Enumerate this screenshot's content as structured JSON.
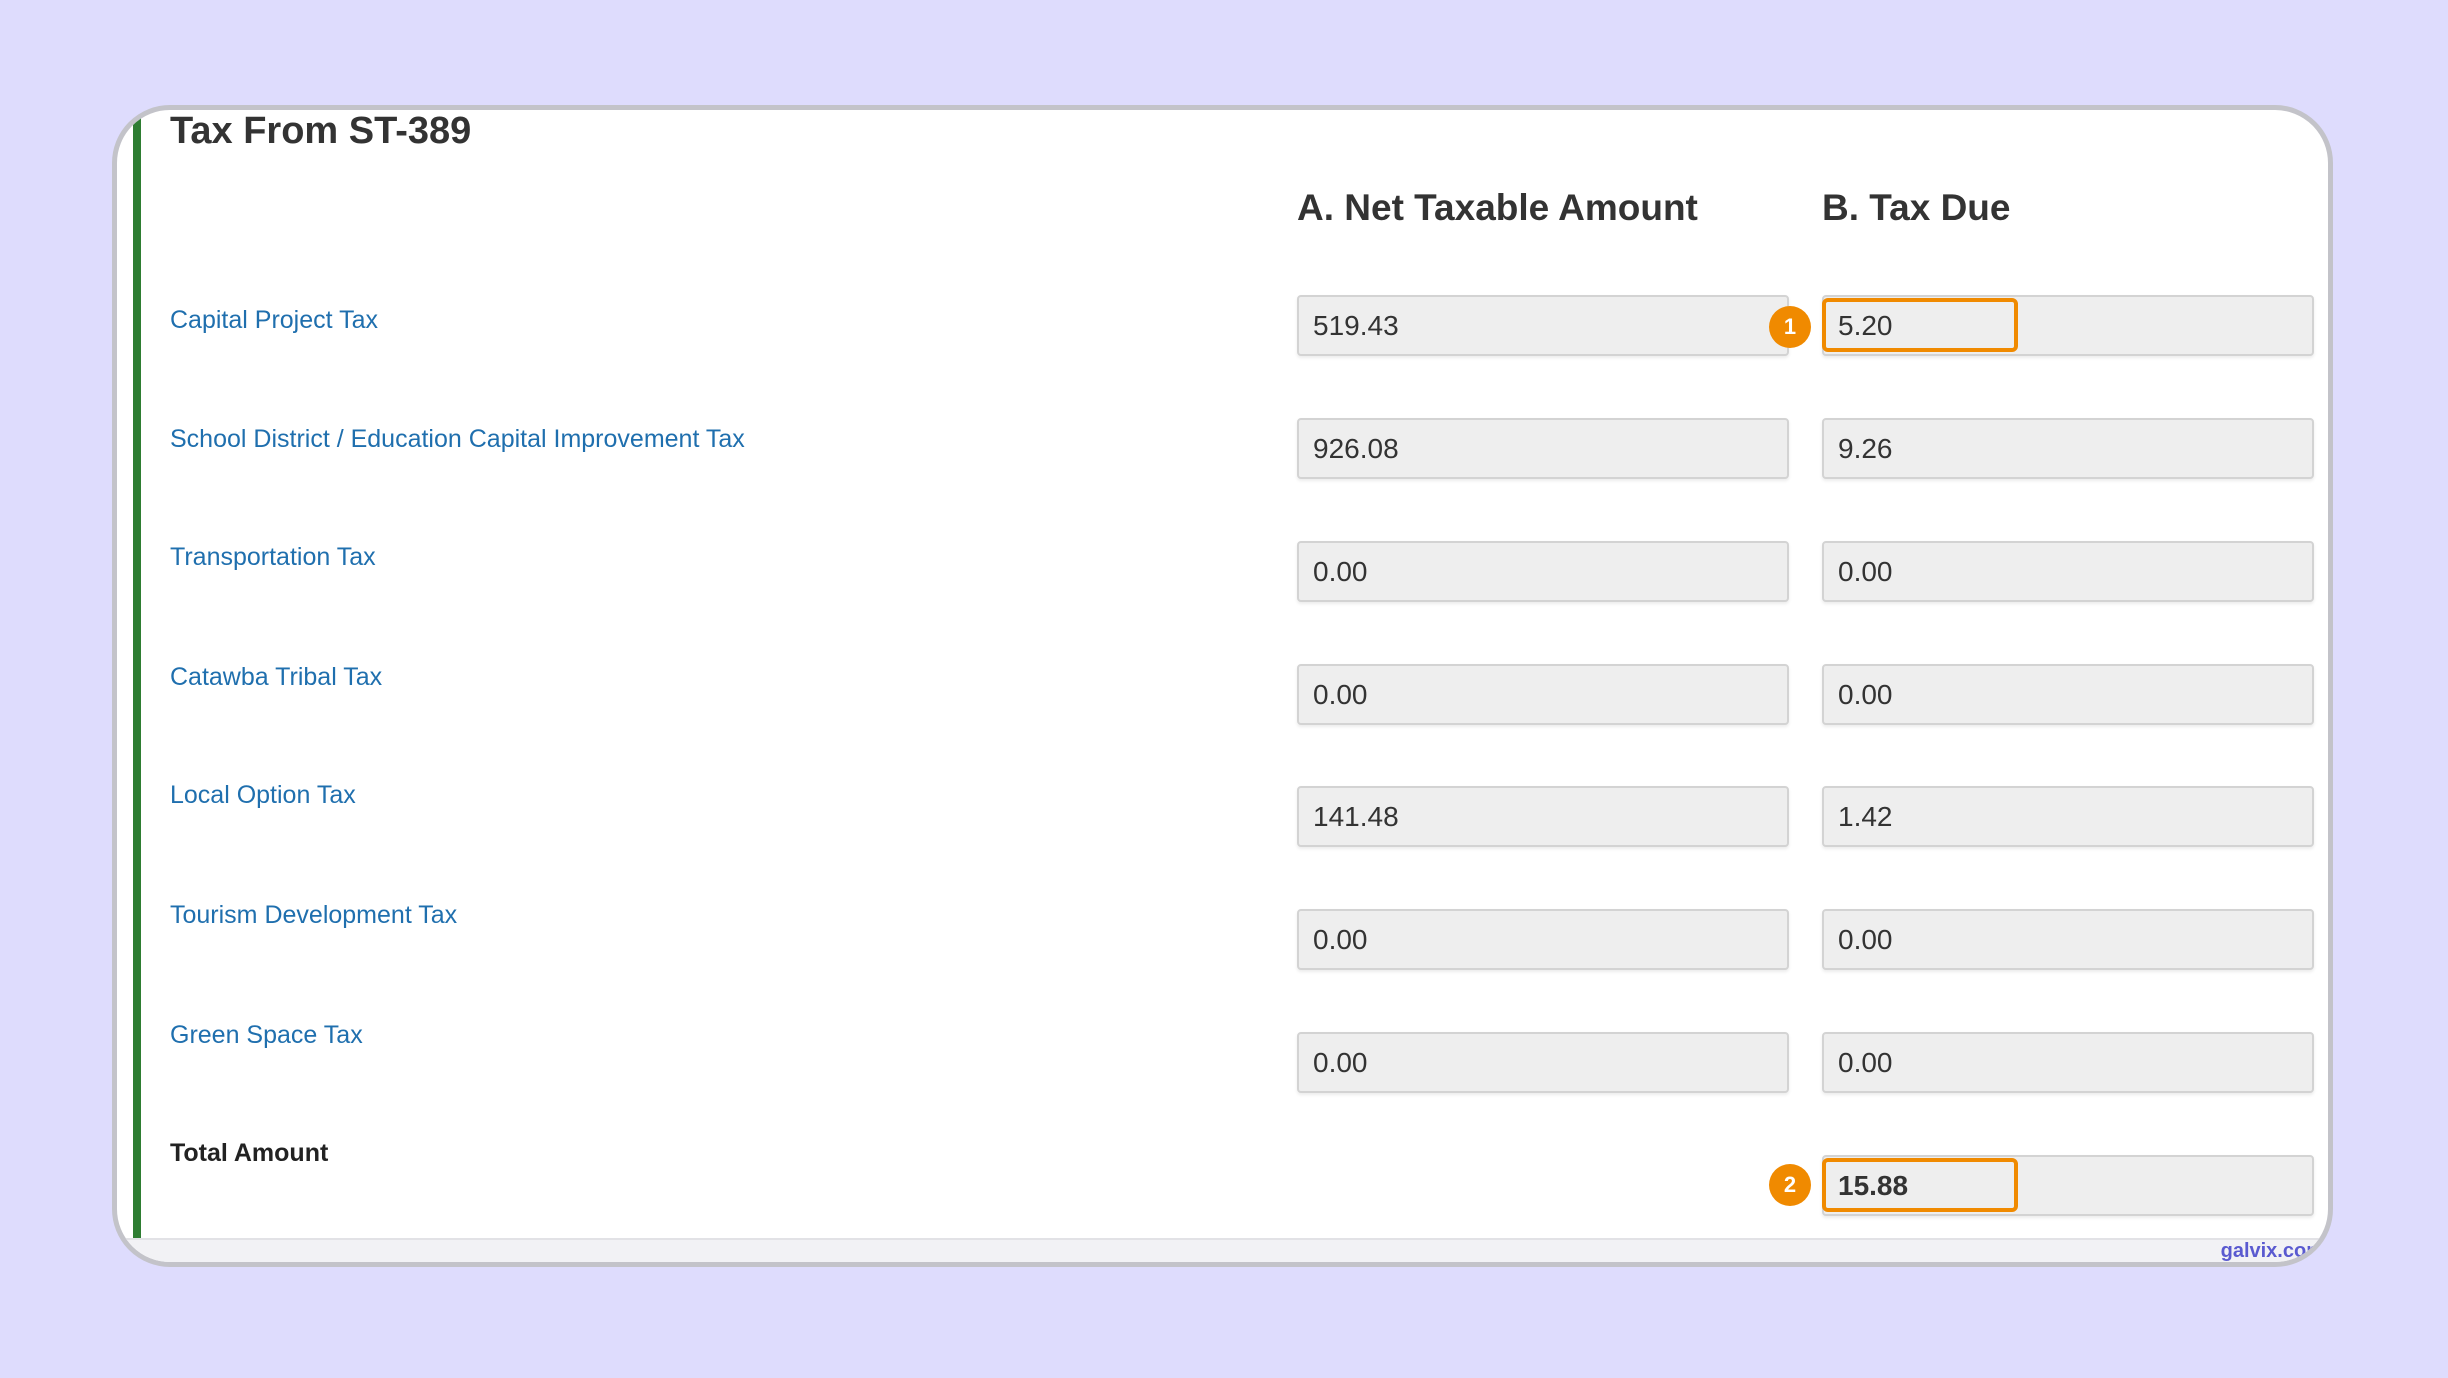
{
  "form": {
    "title": "Tax From ST-389",
    "col_a_header": "A. Net Taxable Amount",
    "col_b_header": "B. Tax Due",
    "rows": [
      {
        "label": "Capital Project Tax",
        "net_taxable": "519.43",
        "tax_due": "5.20"
      },
      {
        "label": "School District / Education Capital Improvement Tax",
        "net_taxable": "926.08",
        "tax_due": "9.26"
      },
      {
        "label": "Transportation Tax",
        "net_taxable": "0.00",
        "tax_due": "0.00"
      },
      {
        "label": "Catawba Tribal Tax",
        "net_taxable": "0.00",
        "tax_due": "0.00"
      },
      {
        "label": "Local Option Tax",
        "net_taxable": "141.48",
        "tax_due": "1.42"
      },
      {
        "label": "Tourism Development Tax",
        "net_taxable": "0.00",
        "tax_due": "0.00"
      },
      {
        "label": "Green Space Tax",
        "net_taxable": "0.00",
        "tax_due": "0.00"
      }
    ],
    "total": {
      "label": "Total Amount",
      "tax_due": "15.88"
    }
  },
  "annotations": {
    "step1": "1",
    "step2": "2",
    "highlight_color": "#f08a00"
  },
  "theme": {
    "background": "#dedcfd",
    "accent_bar": "#2e7d32",
    "label_color": "#1f6fae"
  },
  "watermark": "galvix.com"
}
